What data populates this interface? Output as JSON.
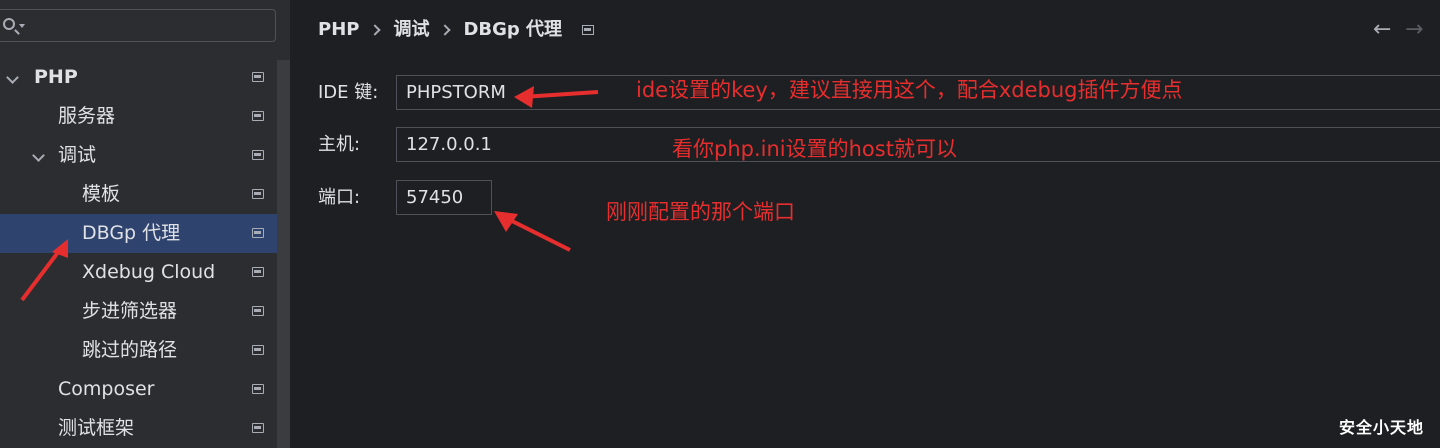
{
  "sidebar": {
    "search": {
      "value": "",
      "placeholder": ""
    },
    "items": [
      {
        "label": "PHP",
        "level": 0,
        "expanded": true,
        "bold": true,
        "selected": false,
        "icon": "project-icon"
      },
      {
        "label": "服务器",
        "level": 1,
        "expanded": false,
        "bold": false,
        "selected": false,
        "icon": "project-icon"
      },
      {
        "label": "调试",
        "level": 1,
        "expanded": true,
        "bold": false,
        "selected": false,
        "icon": "project-icon"
      },
      {
        "label": "模板",
        "level": 2,
        "expanded": false,
        "bold": false,
        "selected": false,
        "icon": "project-icon"
      },
      {
        "label": "DBGp 代理",
        "level": 2,
        "expanded": false,
        "bold": false,
        "selected": true,
        "icon": "project-icon"
      },
      {
        "label": "Xdebug Cloud",
        "level": 2,
        "expanded": false,
        "bold": false,
        "selected": false,
        "icon": "project-icon"
      },
      {
        "label": "步进筛选器",
        "level": 2,
        "expanded": false,
        "bold": false,
        "selected": false,
        "icon": "project-icon"
      },
      {
        "label": "跳过的路径",
        "level": 2,
        "expanded": false,
        "bold": false,
        "selected": false,
        "icon": "project-icon"
      },
      {
        "label": "Composer",
        "level": 1,
        "expanded": false,
        "bold": false,
        "selected": false,
        "icon": "project-icon"
      },
      {
        "label": "测试框架",
        "level": 1,
        "expanded": false,
        "bold": false,
        "selected": false,
        "icon": "project-icon"
      }
    ]
  },
  "breadcrumb": {
    "items": [
      "PHP",
      "调试",
      "DBGp 代理"
    ]
  },
  "nav": {
    "back": "←",
    "forward": "→"
  },
  "form": {
    "ide_key": {
      "label": "IDE 键:",
      "value": "PHPSTORM"
    },
    "host": {
      "label": "主机:",
      "value": "127.0.0.1"
    },
    "port": {
      "label": "端口:",
      "value": "57450"
    }
  },
  "annotations": {
    "ide_key_note": "ide设置的key，建议直接用这个，配合xdebug插件方便点",
    "host_note": "看你php.ini设置的host就可以",
    "port_note": "刚刚配置的那个端口"
  },
  "watermark": "安全小天地",
  "colors": {
    "sidebar_bg": "#2b2d30",
    "main_bg": "#1e1f22",
    "selected_bg": "#2e436e",
    "annotation_red": "#e62e2e",
    "text": "#dfe1e5"
  }
}
